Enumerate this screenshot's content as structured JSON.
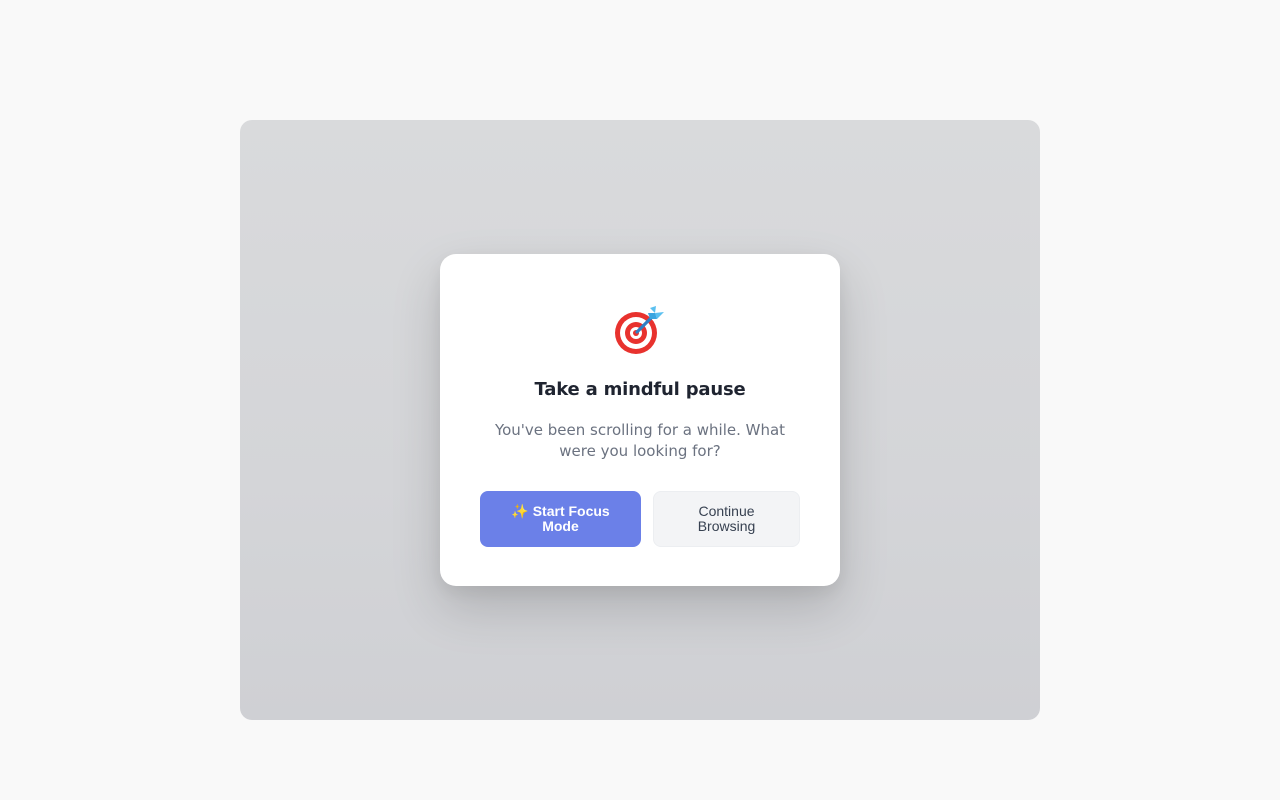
{
  "dialog": {
    "icon": "target-dart-icon",
    "title": "Take a mindful pause",
    "message": "You've been scrolling for a while. What were you looking for?",
    "primary_button": {
      "icon": "sparkles-icon",
      "icon_glyph": "✨",
      "label": "Start Focus Mode",
      "color": "#6b80e8"
    },
    "secondary_button": {
      "label": "Continue Browsing",
      "color": "#f3f4f6"
    }
  },
  "colors": {
    "page_background": "#f9f9f9",
    "overlay": "#d6d7da",
    "title_text": "#1f2430",
    "body_text": "#6b7280"
  }
}
